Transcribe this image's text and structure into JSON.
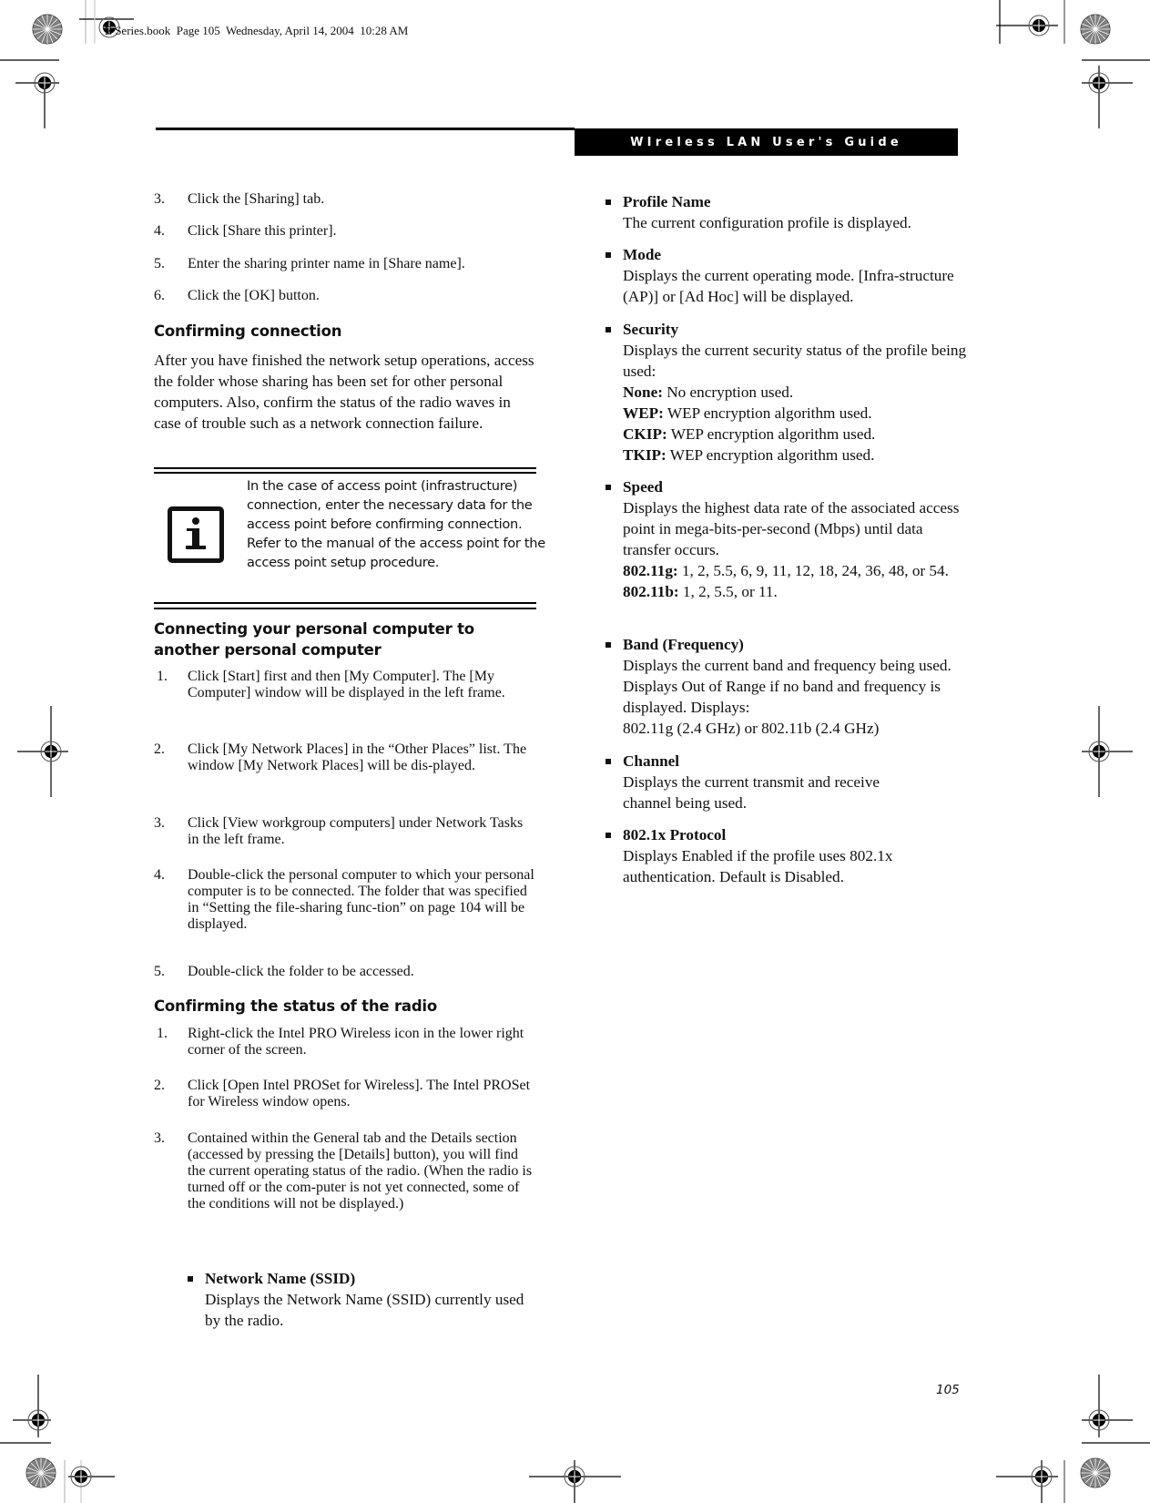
{
  "print_slug": "E Series.book  Page 105  Wednesday, April 14, 2004  10:28 AM",
  "header": {
    "title": "WIreless LAN User's Guide"
  },
  "left_column": {
    "steps_top": [
      {
        "num": "3.",
        "text": "Click the [Sharing] tab."
      },
      {
        "num": "4.",
        "text": "Click [Share this printer]."
      },
      {
        "num": "5.",
        "text": "Enter the sharing printer name in [Share name]."
      },
      {
        "num": "6.",
        "text": "Click the [OK] button."
      }
    ],
    "confirming_connection": {
      "heading": "Confirming connection",
      "paragraph": "After you have finished the network setup operations, access the folder whose sharing has been set for other personal computers. Also, confirm the status of the radio waves in case of trouble such as a network connection failure."
    },
    "note": {
      "icon": "info-icon",
      "text": "In the case of access point (infrastructure) connection, enter the necessary data for the access point before confirming connection. Refer to the manual of the access point for the access point setup procedure."
    },
    "connecting_section": {
      "heading": "Connecting your personal computer to another personal computer",
      "steps": [
        {
          "num": "1.",
          "text": "Click [Start] first and then [My Computer]. The [My Computer] window will be displayed in the left frame."
        },
        {
          "num": "2.",
          "text": "Click [My Network Places] in the “Other Places” list. The window [My Network Places] will be dis-played."
        },
        {
          "num": "3.",
          "text": "Click [View workgroup computers] under Network Tasks in the left frame."
        },
        {
          "num": "4.",
          "text": "Double-click the personal computer to which your personal computer is to be connected. The folder that was specified in “Setting the file-sharing func-tion” on page 104 will be displayed."
        },
        {
          "num": "5.",
          "text": "Double-click the folder to be accessed."
        }
      ]
    },
    "radio_section": {
      "heading": "Confirming the status of the radio",
      "steps": [
        {
          "num": "1.",
          "text": "Right-click the Intel PRO Wireless icon in the lower right corner of the screen."
        },
        {
          "num": "2.",
          "text": "Click [Open Intel PROSet for Wireless]. The Intel PROSet for Wireless window opens."
        },
        {
          "num": "3.",
          "text": "Contained within the General tab and the Details section (accessed by pressing the [Details] button), you will find the current operating status of the radio. (When the radio is turned off or the com-puter is not yet connected, some of the conditions will not be displayed.)"
        }
      ],
      "bullet": {
        "title": "Network Name (SSID)",
        "text": "Displays the Network Name (SSID) currently used by the radio."
      }
    }
  },
  "right_column": {
    "bullets": [
      {
        "title": "Profile Name",
        "lines": [
          {
            "text": "The current configuration profile is displayed."
          }
        ]
      },
      {
        "title": "Mode",
        "lines": [
          {
            "text": "Displays the current operating mode. [Infra-structure (AP)] or [Ad Hoc] will be displayed."
          }
        ]
      },
      {
        "title": "Security",
        "lines": [
          {
            "text": "Displays the current security status of the profile being used:"
          },
          {
            "label": "None:",
            "text": " No encryption used."
          },
          {
            "label": "WEP:",
            "text": " WEP encryption algorithm used."
          },
          {
            "label": "CKIP:",
            "text": " WEP encryption algorithm used."
          },
          {
            "label": "TKIP:",
            "text": " WEP encryption algorithm used."
          }
        ]
      },
      {
        "title": "Speed",
        "lines": [
          {
            "text": "Displays the highest data rate of the associated access point in mega-bits-per-second (Mbps) until data transfer occurs."
          },
          {
            "label": "802.11g:",
            "text": " 1, 2, 5.5, 6, 9, 11, 12, 18, 24, 36, 48, or 54."
          },
          {
            "label": "802.11b:",
            "text": " 1, 2, 5.5, or 11."
          }
        ]
      },
      {
        "title": "Band (Frequency)",
        "lines": [
          {
            "text": "Displays the current band and frequency being used. Displays Out of Range if no band and frequency is displayed. Displays:"
          },
          {
            "text": "802.11g (2.4 GHz) or 802.11b (2.4 GHz)"
          }
        ]
      },
      {
        "title": "Channel",
        "lines": [
          {
            "text": "Displays the current transmit and receive channel being used."
          }
        ]
      },
      {
        "title": "802.1x Protocol",
        "lines": [
          {
            "text": "Displays Enabled if the profile uses 802.1x authentication. Default is Disabled."
          }
        ]
      }
    ]
  },
  "footer": {
    "page_number": "105"
  }
}
